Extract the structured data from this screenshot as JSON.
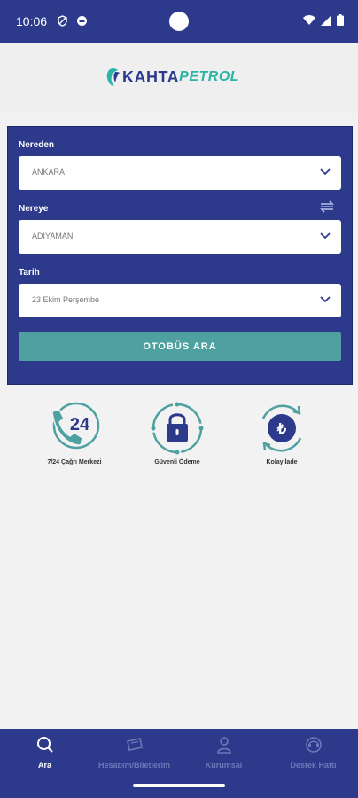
{
  "status_bar": {
    "time": "10:06"
  },
  "header": {
    "logo_part1": "KAHTA",
    "logo_part2": "PETROL"
  },
  "search_form": {
    "from_label": "Nereden",
    "from_value": "ANKARA",
    "to_label": "Nereye",
    "to_value": "ADIYAMAN",
    "date_label": "Tarih",
    "date_value": "23 Ekim Perşembe",
    "search_button": "OTOBÜS ARA"
  },
  "features": [
    {
      "label": "7/24 Çağrı Merkezi",
      "icon": "phone-24-icon"
    },
    {
      "label": "Güvenli Ödeme",
      "icon": "lock-icon"
    },
    {
      "label": "Kolay İade",
      "icon": "lira-refund-icon"
    }
  ],
  "bottom_nav": [
    {
      "label": "Ara",
      "icon": "search-icon",
      "active": true
    },
    {
      "label": "Hesabım/Biletlerim",
      "icon": "ticket-icon",
      "active": false
    },
    {
      "label": "Kurumsal",
      "icon": "person-icon",
      "active": false
    },
    {
      "label": "Destek Hattı",
      "icon": "support-icon",
      "active": false
    }
  ],
  "colors": {
    "primary": "#2d3a8c",
    "accent": "#2bb3a6",
    "button": "#4ea1a0",
    "background": "#f2f2f2"
  }
}
